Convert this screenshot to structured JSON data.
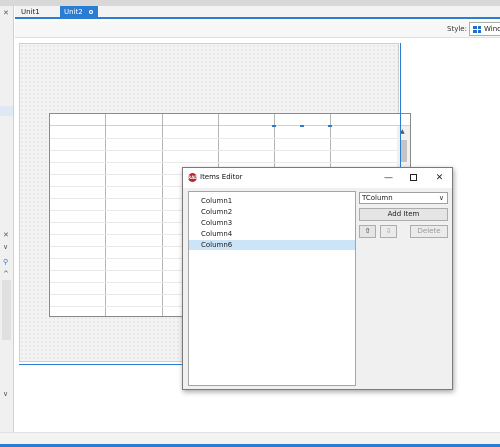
{
  "tabs": [
    {
      "label": "Unit1",
      "active": false
    },
    {
      "label": "Unit2",
      "active": true
    }
  ],
  "style_bar": {
    "label": "Style:",
    "value": "Windows"
  },
  "left_panel": {
    "close_glyph": "✕",
    "expand_glyph": "∨",
    "collapse_glyph": "^"
  },
  "dialog": {
    "title": "Items Editor",
    "logo_text": "RAD",
    "items": [
      {
        "label": "Column1",
        "selected": false
      },
      {
        "label": "Column2",
        "selected": false
      },
      {
        "label": "Column3",
        "selected": false
      },
      {
        "label": "Column4",
        "selected": false
      },
      {
        "label": "Column6",
        "selected": true
      }
    ],
    "class_selector": "TColumn",
    "add_button": "Add Item",
    "delete_button": "Delete",
    "up_glyph": "⇧",
    "down_glyph": "⇩",
    "min_glyph": "—",
    "close_glyph": "✕"
  },
  "colors": {
    "accent": "#2b7cd3",
    "selection": "#cce4f7",
    "logo": "#b8262b"
  }
}
